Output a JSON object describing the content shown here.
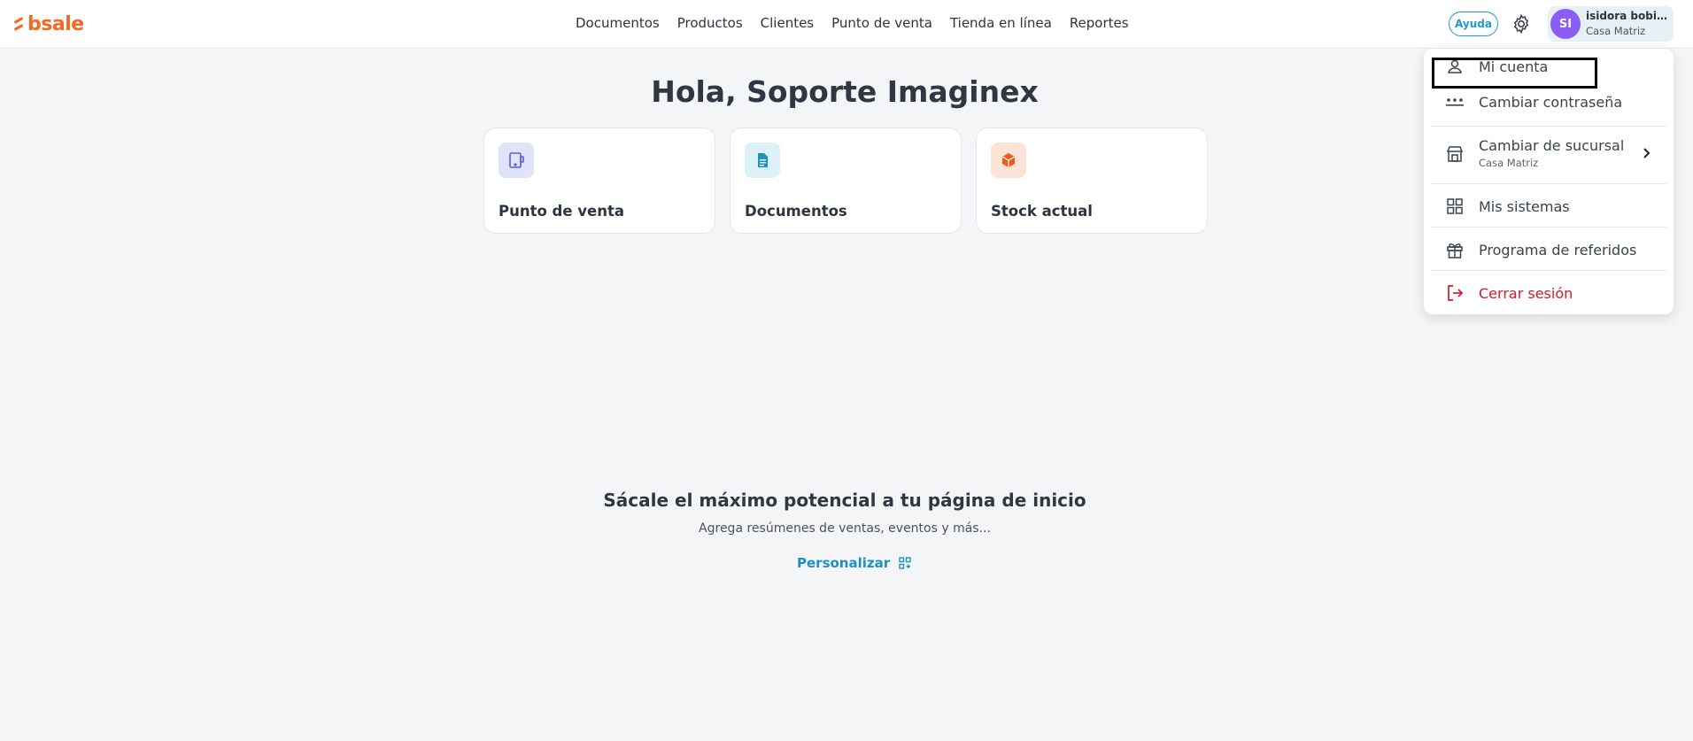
{
  "brand": {
    "name": "bsale",
    "color": "#f26a21"
  },
  "nav": {
    "items": [
      "Documentos",
      "Productos",
      "Clientes",
      "Punto de venta",
      "Tienda en línea",
      "Reportes"
    ]
  },
  "header": {
    "help_label": "Ayuda",
    "user": {
      "initials": "SI",
      "name": "isidora bobilli...",
      "branch": "Casa Matriz",
      "avatar_color": "#8b5cf6"
    }
  },
  "main": {
    "greeting": "Hola, Soporte Imaginex",
    "cards": [
      {
        "label": "Punto de venta",
        "icon": "tablet-pos-icon"
      },
      {
        "label": "Documentos",
        "icon": "document-icon"
      },
      {
        "label": "Stock actual",
        "icon": "box-icon"
      }
    ],
    "promo": {
      "title": "Sácale el máximo potencial a tu página de inicio",
      "subtitle": "Agrega resúmenes de ventas, eventos y más...",
      "action": "Personalizar"
    }
  },
  "menu": {
    "items": [
      {
        "label": "Mi cuenta",
        "icon": "user-icon"
      },
      {
        "label": "Cambiar contraseña",
        "icon": "password-dots-icon"
      },
      {
        "label": "Cambiar de sucursal",
        "sub": "Casa Matriz",
        "icon": "store-icon"
      },
      {
        "label": "Mis sistemas",
        "icon": "grid-icon"
      },
      {
        "label": "Programa de referidos",
        "icon": "gift-icon"
      },
      {
        "label": "Cerrar sesión",
        "icon": "logout-icon",
        "color": "#d11a2a"
      }
    ]
  },
  "colors": {
    "accent": "#1d9bd1",
    "danger": "#d11a2a"
  }
}
